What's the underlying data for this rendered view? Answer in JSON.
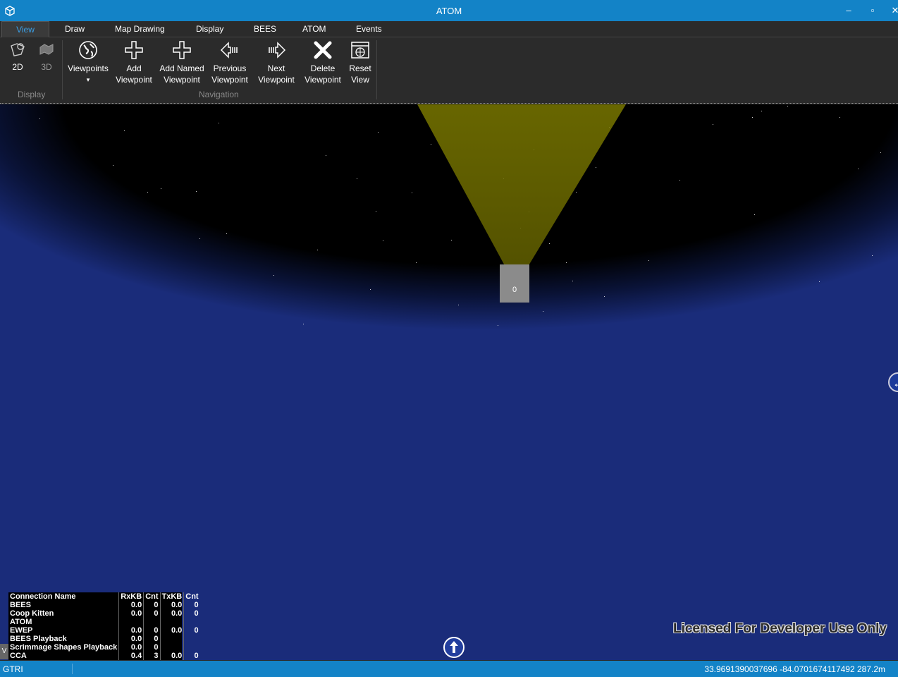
{
  "window": {
    "title": "ATOM",
    "controls": {
      "minimize": "–",
      "maximize": "▫",
      "close": "✕"
    }
  },
  "tabs": [
    {
      "label": "View",
      "active": true
    },
    {
      "label": "Draw"
    },
    {
      "label": "Map Drawing"
    },
    {
      "label": "Display"
    },
    {
      "label": "BEES"
    },
    {
      "label": "ATOM"
    },
    {
      "label": "Events"
    }
  ],
  "ribbon": {
    "display_group": {
      "label": "Display",
      "buttons": [
        {
          "label": "2D",
          "icon": "map-2d-icon"
        },
        {
          "label": "3D",
          "icon": "map-3d-icon"
        }
      ]
    },
    "navigation_group": {
      "label": "Navigation",
      "buttons": [
        {
          "line1": "Viewpoints",
          "line2": "▾",
          "icon": "globe-icon"
        },
        {
          "line1": "Add",
          "line2": "Viewpoint",
          "icon": "plus-icon"
        },
        {
          "line1": "Add Named",
          "line2": "Viewpoint",
          "icon": "plus-icon"
        },
        {
          "line1": "Previous",
          "line2": "Viewpoint",
          "icon": "arrow-left-icon"
        },
        {
          "line1": "Next",
          "line2": "Viewpoint",
          "icon": "arrow-right-icon"
        },
        {
          "line1": "Delete",
          "line2": "Viewpoint",
          "icon": "delete-x-icon"
        },
        {
          "line1": "Reset",
          "line2": "View",
          "icon": "reset-view-icon"
        }
      ]
    }
  },
  "map": {
    "marker_label": "0",
    "license_text": "Licensed For Developer Use Only",
    "colors": {
      "space": "#000000",
      "atmosphere": "#3b5fc9",
      "cone": "#6b6a00"
    }
  },
  "connections": {
    "headers": [
      "Connection Name",
      "RxKB",
      "Cnt",
      "TxKB",
      "Cnt"
    ],
    "rows": [
      [
        "BEES",
        "0.0",
        "0",
        "0.0",
        "0"
      ],
      [
        "Coop Kitten",
        "0.0",
        "0",
        "0.0",
        "0"
      ],
      [
        "ATOM",
        "",
        "",
        "",
        ""
      ],
      [
        "EWEP",
        "0.0",
        "0",
        "0.0",
        "0"
      ],
      [
        "BEES Playback",
        "0.0",
        "0",
        "",
        ""
      ],
      [
        "Scrimmage Shapes Playback",
        "0.0",
        "0",
        "",
        ""
      ],
      [
        "CCA",
        "0.4",
        "3",
        "0.0",
        "0"
      ]
    ],
    "toggle_label": "V"
  },
  "status": {
    "left": "GTRI",
    "coords": "33.9691390037696 -84.0701674117492  287.2m"
  }
}
